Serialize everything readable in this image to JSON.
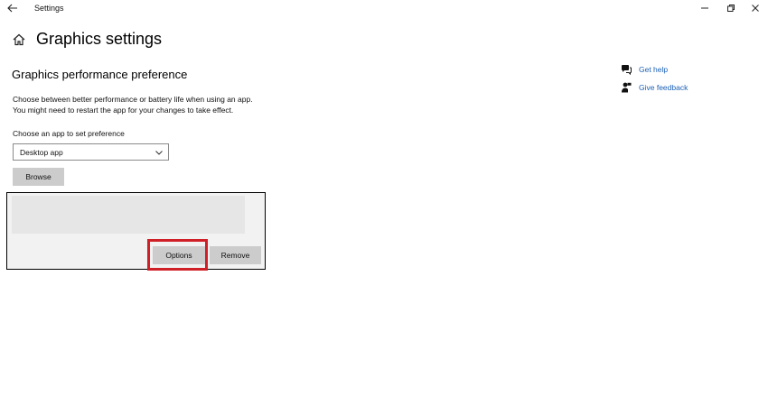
{
  "window": {
    "title": "Settings",
    "back_icon": "back-arrow-icon",
    "controls": [
      "minimize-icon",
      "restore-icon",
      "close-icon"
    ]
  },
  "page": {
    "title": "Graphics settings",
    "home_icon": "home-icon"
  },
  "graphics_pref": {
    "heading": "Graphics performance preference",
    "description_line1": "Choose between better performance or battery life when using an app.",
    "description_line2": "You might need to restart the app for your changes to take effect.",
    "choose_label": "Choose an app to set preference",
    "selected_app_type": "Desktop app",
    "browse_label": "Browse"
  },
  "app_list": {
    "options_label": "Options",
    "remove_label": "Remove",
    "highlight_color": "#d02027"
  },
  "help": {
    "get_help": "Get help",
    "give_feedback": "Give feedback",
    "link_color": "#1a5fb4"
  }
}
